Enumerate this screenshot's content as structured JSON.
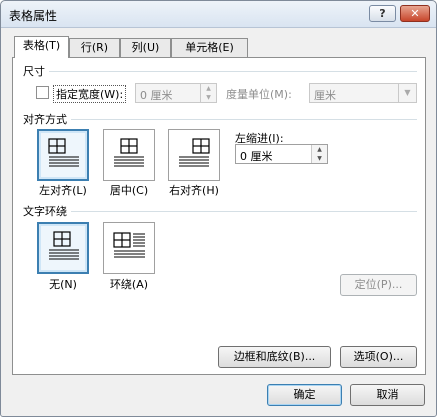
{
  "window": {
    "title": "表格属性",
    "help_label": "?",
    "close_label": "✕"
  },
  "tabs": [
    {
      "label": "表格(T)",
      "active": true
    },
    {
      "label": "行(R)",
      "active": false
    },
    {
      "label": "列(U)",
      "active": false
    },
    {
      "label": "单元格(E)",
      "active": false
    }
  ],
  "size": {
    "heading": "尺寸",
    "preferred_width_label": "指定宽度(W):",
    "preferred_width_checked": false,
    "width_value": "0 厘米",
    "measure_label": "度量单位(M):",
    "measure_value": "厘米"
  },
  "alignment": {
    "heading": "对齐方式",
    "options": [
      {
        "label": "左对齐(L)",
        "selected": true,
        "icon": "table-align-left-icon"
      },
      {
        "label": "居中(C)",
        "selected": false,
        "icon": "table-align-center-icon"
      },
      {
        "label": "右对齐(H)",
        "selected": false,
        "icon": "table-align-right-icon"
      }
    ],
    "indent_label": "左缩进(I):",
    "indent_value": "0 厘米"
  },
  "wrapping": {
    "heading": "文字环绕",
    "options": [
      {
        "label": "无(N)",
        "selected": true,
        "icon": "wrap-none-icon"
      },
      {
        "label": "环绕(A)",
        "selected": false,
        "icon": "wrap-around-icon"
      }
    ],
    "positioning_label": "定位(P)..."
  },
  "borders_button": "边框和底纹(B)...",
  "options_button": "选项(O)...",
  "ok_button": "确定",
  "cancel_button": "取消",
  "colors": {
    "selected_border": "#3c7fb1",
    "title_bar": "#dfe8f3"
  }
}
